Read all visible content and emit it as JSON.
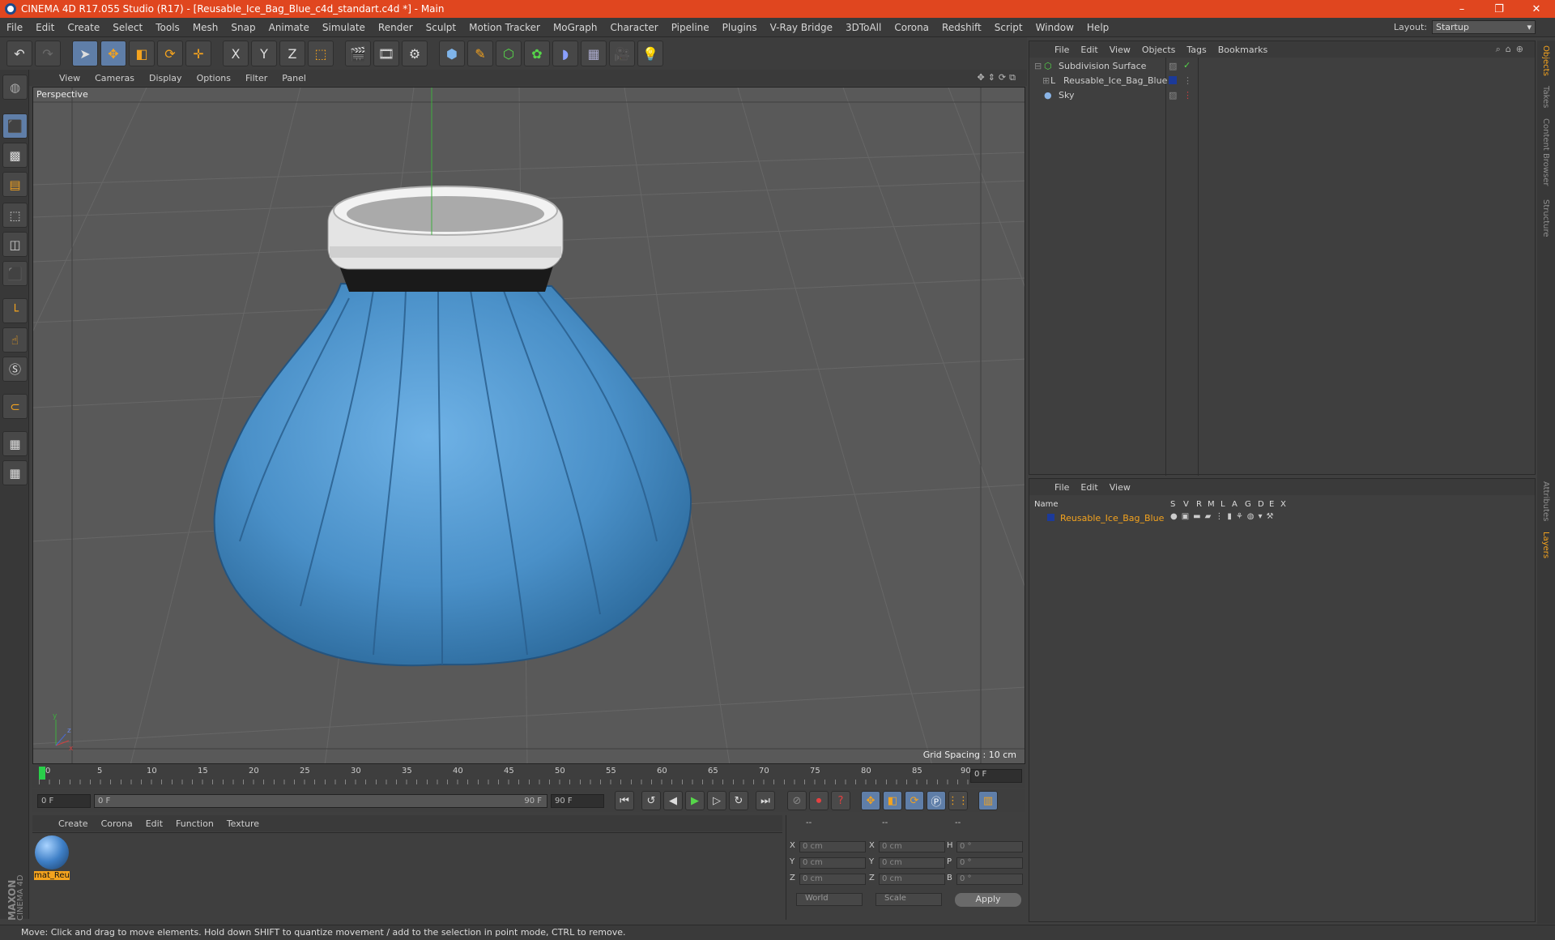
{
  "window": {
    "title": "CINEMA 4D R17.055 Studio (R17) - [Reusable_Ice_Bag_Blue_c4d_standart.c4d *] - Main",
    "controls": [
      "–",
      "❐",
      "✕"
    ]
  },
  "menubar": {
    "items": [
      "File",
      "Edit",
      "Create",
      "Select",
      "Tools",
      "Mesh",
      "Snap",
      "Animate",
      "Simulate",
      "Render",
      "Sculpt",
      "Motion Tracker",
      "MoGraph",
      "Character",
      "Pipeline",
      "Plugins",
      "V-Ray Bridge",
      "3DToAll",
      "Corona",
      "Redshift",
      "Script",
      "Window",
      "Help"
    ],
    "layout_label": "Layout:",
    "layout_value": "Startup"
  },
  "toolbar": {
    "axis_x": "X",
    "axis_y": "Y",
    "axis_z": "Z"
  },
  "viewport": {
    "menu": [
      "View",
      "Cameras",
      "Display",
      "Options",
      "Filter",
      "Panel"
    ],
    "label": "Perspective",
    "grid_spacing": "Grid Spacing : 10 cm",
    "axis_y": "y",
    "axis_x": "x",
    "axis_z": "z"
  },
  "timeline": {
    "ticks": [
      "0",
      "5",
      "10",
      "15",
      "20",
      "25",
      "30",
      "35",
      "40",
      "45",
      "50",
      "55",
      "60",
      "65",
      "70",
      "75",
      "80",
      "85",
      "90"
    ],
    "current_frame": "0 F",
    "start_field": "0 F",
    "range_start": "0 F",
    "range_end": "90 F",
    "end_field": "90 F"
  },
  "material_manager": {
    "menu": [
      "Create",
      "Corona",
      "Edit",
      "Function",
      "Texture"
    ],
    "material_name": "mat_Reu"
  },
  "coordinates": {
    "headers": [
      "--",
      "--",
      "--"
    ],
    "rows": [
      {
        "a": "X",
        "av": "0 cm",
        "b": "X",
        "bv": "0 cm",
        "c": "H",
        "cv": "0 °"
      },
      {
        "a": "Y",
        "av": "0 cm",
        "b": "Y",
        "bv": "0 cm",
        "c": "P",
        "cv": "0 °"
      },
      {
        "a": "Z",
        "av": "0 cm",
        "b": "Z",
        "bv": "0 cm",
        "c": "B",
        "cv": "0 °"
      }
    ],
    "space": "World",
    "mode": "Scale",
    "apply": "Apply"
  },
  "objects_panel": {
    "menu": [
      "File",
      "Edit",
      "View",
      "Objects",
      "Tags",
      "Bookmarks"
    ],
    "items": [
      {
        "name": "Subdivision Surface"
      },
      {
        "name": "Reusable_Ice_Bag_Blue"
      },
      {
        "name": "Sky"
      }
    ]
  },
  "layers_panel": {
    "menu": [
      "File",
      "Edit",
      "View"
    ],
    "col_name": "Name",
    "cols": [
      "S",
      "V",
      "R",
      "M",
      "L",
      "A",
      "G",
      "D",
      "E",
      "X"
    ],
    "layer_name": "Reusable_Ice_Bag_Blue"
  },
  "side_tabs": [
    "Objects",
    "Takes",
    "Content Browser",
    "Structure",
    "Attributes",
    "Layers"
  ],
  "brand": {
    "maxon": "MAXON",
    "c4d": "CINEMA 4D"
  },
  "status": "Move: Click and drag to move elements. Hold down SHIFT to quantize movement / add to the selection in point mode, CTRL to remove.",
  "colors": {
    "accent": "#e0461f",
    "highlight": "#f4a31e",
    "bag": "#4a90c8",
    "selection": "#5f7ea8"
  }
}
